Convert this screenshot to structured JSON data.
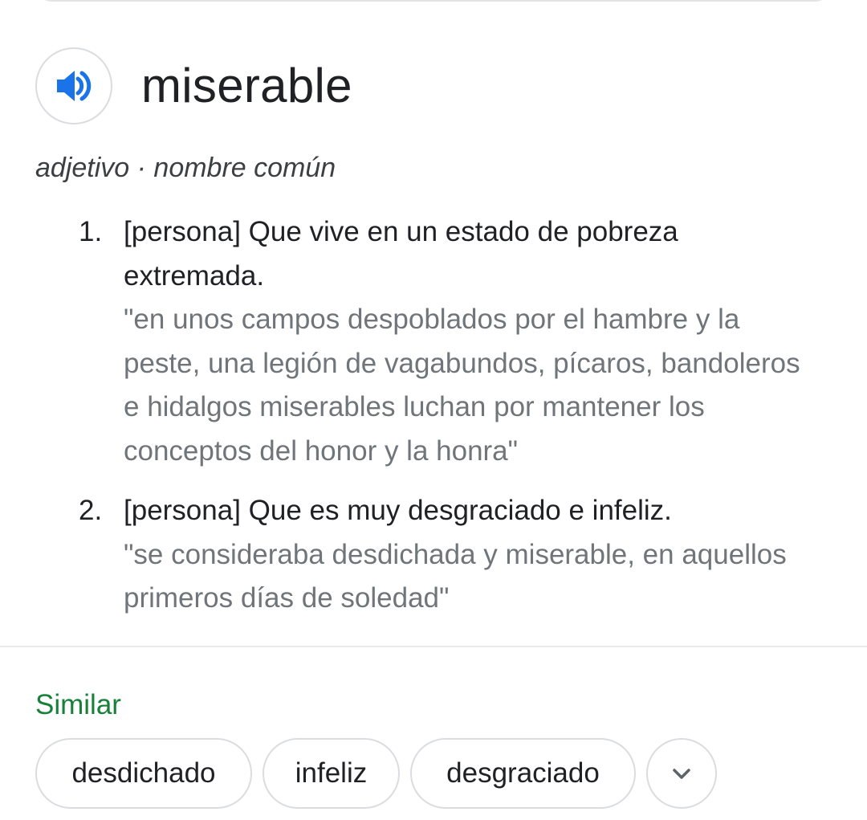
{
  "entry": {
    "word": "miserable",
    "part_of_speech": "adjetivo · nombre común",
    "definitions": [
      {
        "number": "1.",
        "text": "[persona] Que vive en un estado de pobreza extremada.",
        "example": "\"en unos campos despoblados por el hambre y la peste, una legión de vagabundos, pícaros, bandoleros e hidalgos miserables luchan por mantener los conceptos del honor y la honra\""
      },
      {
        "number": "2.",
        "text": "[persona] Que es muy desgraciado e infeliz.",
        "example": "\"se consideraba desdichada y miserable, en aquellos primeros días de soledad\""
      }
    ]
  },
  "similar": {
    "title": "Similar",
    "chips": [
      "desdichado",
      "infeliz",
      "desgraciado"
    ],
    "expand_icon": "chevron-down-icon"
  },
  "icons": {
    "pronunciation": "speaker-icon"
  },
  "colors": {
    "speaker_blue": "#1a73e8",
    "similar_green": "#188038",
    "example_gray": "#70757a"
  }
}
